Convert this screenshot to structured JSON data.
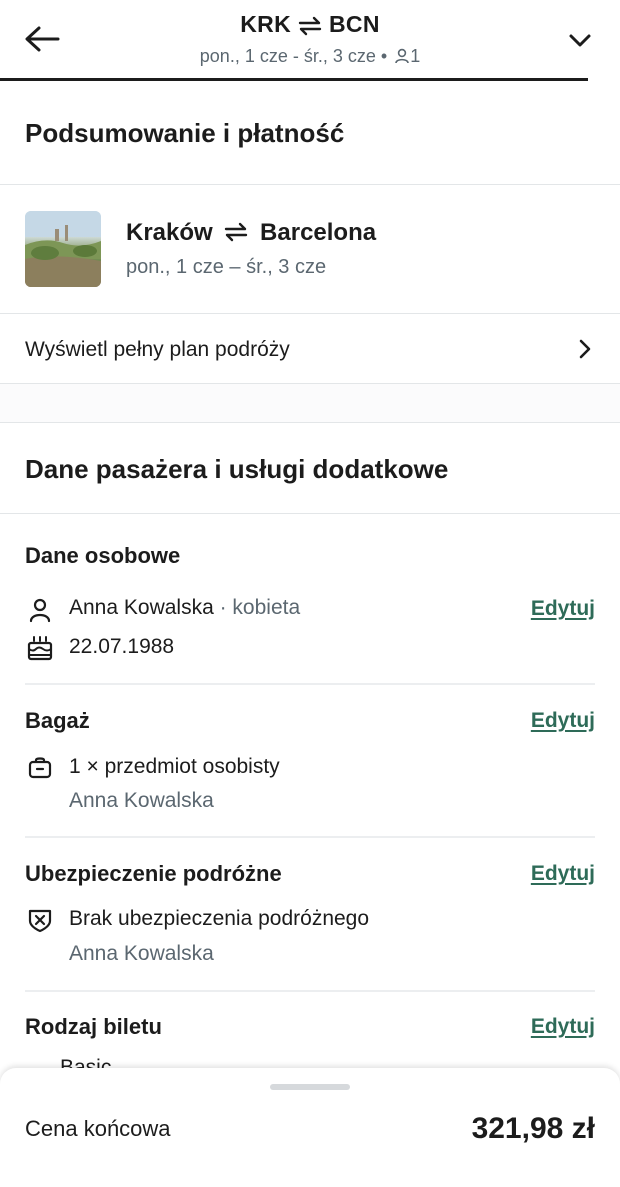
{
  "header": {
    "origin": "KRK",
    "destination": "BCN",
    "subtitle": "pon., 1 cze - śr., 3 cze •",
    "passengers": "1"
  },
  "summary": {
    "title": "Podsumowanie i płatność"
  },
  "trip": {
    "from": "Kraków",
    "to": "Barcelona",
    "dates": "pon., 1 cze – śr., 3 cze",
    "full_plan_label": "Wyświetl pełny plan podróży"
  },
  "passenger_section": {
    "title": "Dane pasażera i usługi dodatkowe"
  },
  "personal": {
    "title": "Dane osobowe",
    "name": "Anna Kowalska",
    "gender": "· kobieta",
    "birthdate": "22.07.1988",
    "edit_label": "Edytuj"
  },
  "baggage": {
    "title": "Bagaż",
    "item": "1 × przedmiot osobisty",
    "owner": "Anna Kowalska",
    "edit_label": "Edytuj"
  },
  "insurance": {
    "title": "Ubezpieczenie podróżne",
    "item": "Brak ubezpieczenia podróżnego",
    "owner": "Anna Kowalska",
    "edit_label": "Edytuj"
  },
  "ticket": {
    "title": "Rodzaj biletu",
    "edit_label": "Edytuj",
    "peek_text": "Basic"
  },
  "footer": {
    "label": "Cena końcowa",
    "price": "321,98 zł"
  }
}
